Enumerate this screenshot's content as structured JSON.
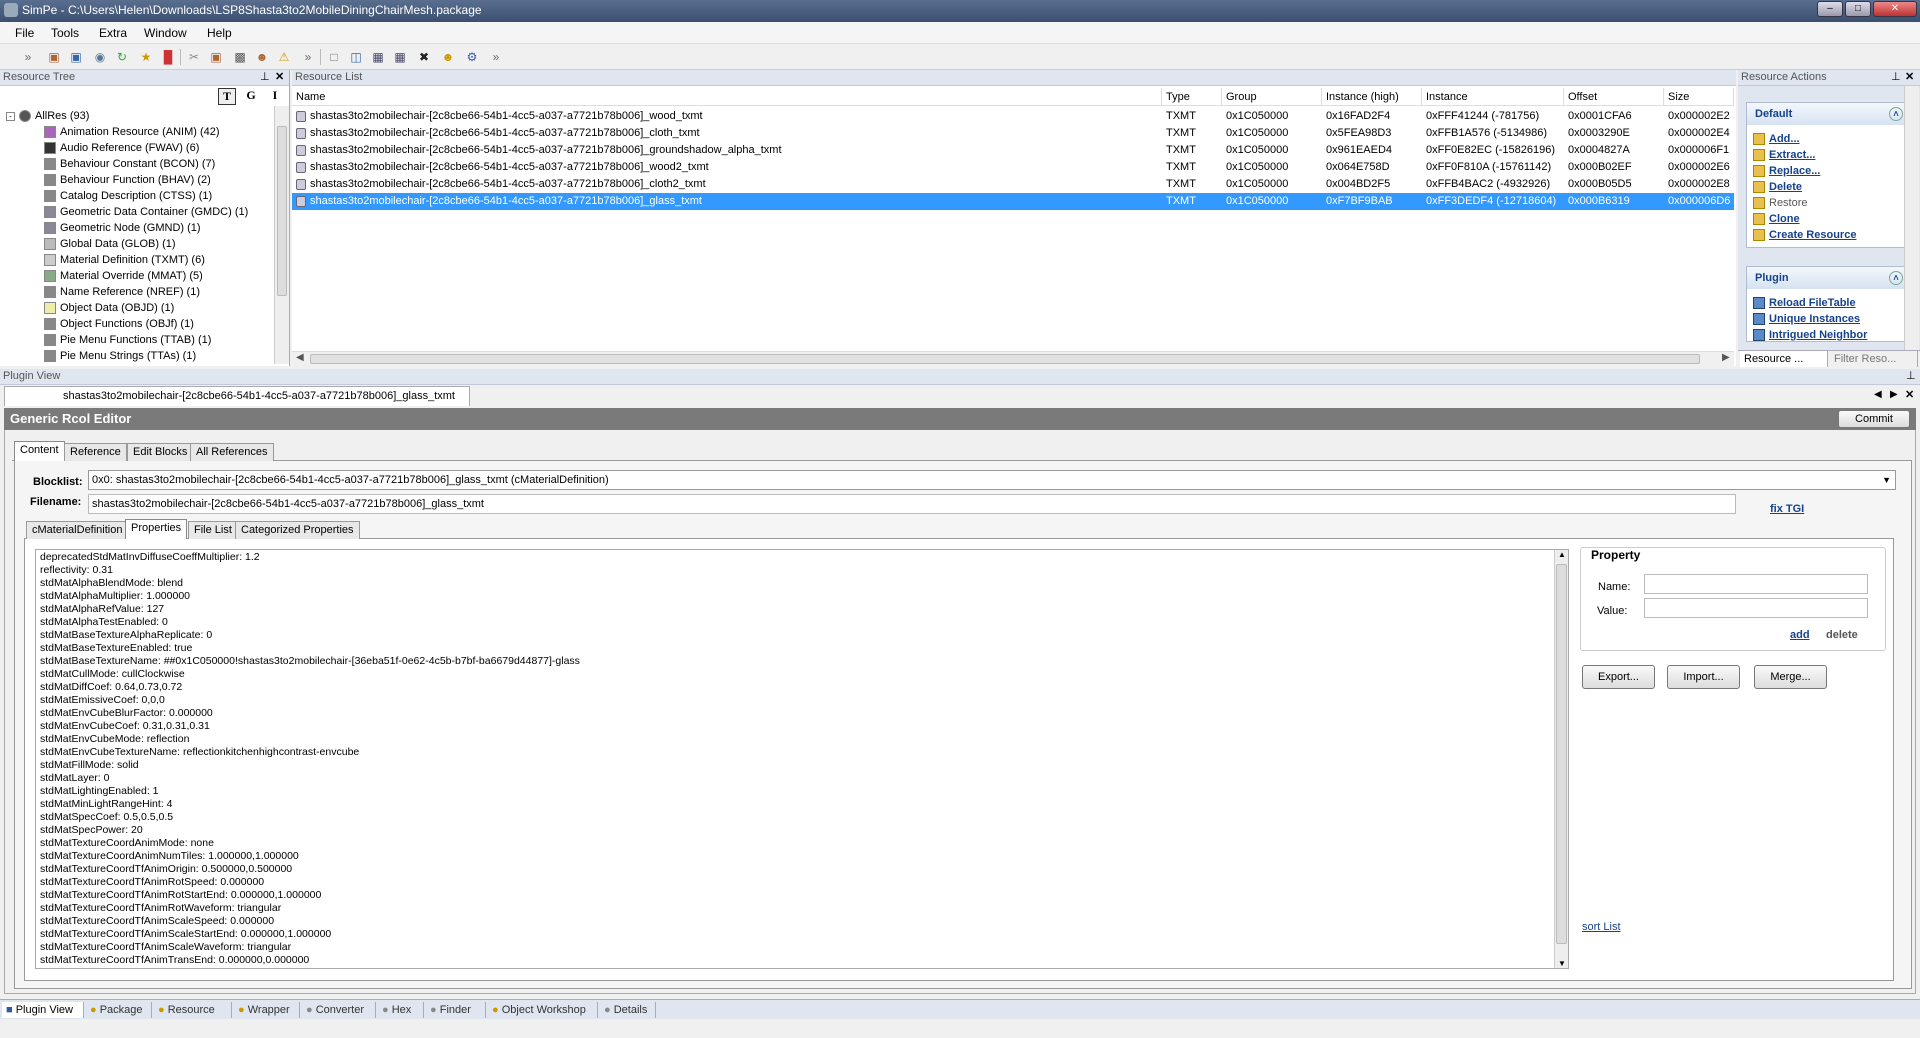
{
  "window": {
    "title": "SimPe - C:\\Users\\Helen\\Downloads\\LSP8Shasta3to2MobileDiningChairMesh.package"
  },
  "menu": [
    "File",
    "Tools",
    "Extra",
    "Window",
    "Help"
  ],
  "resource_tree": {
    "header": "Resource Tree",
    "view_buttons": [
      "T",
      "G",
      "I"
    ],
    "root": "AllRes (93)",
    "items": [
      "Animation Resource (ANIM) (42)",
      "Audio Reference (FWAV) (6)",
      "Behaviour Constant (BCON) (7)",
      "Behaviour Function (BHAV) (2)",
      "Catalog Description (CTSS) (1)",
      "Geometric Data Container (GMDC) (1)",
      "Geometric Node (GMND) (1)",
      "Global Data (GLOB) (1)",
      "Material Definition (TXMT) (6)",
      "Material Override (MMAT) (5)",
      "Name Reference (NREF) (1)",
      "Object Data (OBJD) (1)",
      "Object Functions (OBJf) (1)",
      "Pie Menu Functions (TTAB) (1)",
      "Pie Menu Strings (TTAs) (1)"
    ]
  },
  "resource_list": {
    "header": "Resource List",
    "columns": [
      "Name",
      "Type",
      "Group",
      "Instance (high)",
      "Instance",
      "Offset",
      "Size"
    ],
    "rows": [
      [
        "shastas3to2mobilechair-[2c8cbe66-54b1-4cc5-a037-a7721b78b006]_wood_txmt",
        "TXMT",
        "0x1C050000",
        "0x16FAD2F4",
        "0xFFF41244 (-781756)",
        "0x0001CFA6",
        "0x000002E2"
      ],
      [
        "shastas3to2mobilechair-[2c8cbe66-54b1-4cc5-a037-a7721b78b006]_cloth_txmt",
        "TXMT",
        "0x1C050000",
        "0x5FEA98D3",
        "0xFFB1A576 (-5134986)",
        "0x0003290E",
        "0x000002E4"
      ],
      [
        "shastas3to2mobilechair-[2c8cbe66-54b1-4cc5-a037-a7721b78b006]_groundshadow_alpha_txmt",
        "TXMT",
        "0x1C050000",
        "0x961EAED4",
        "0xFF0E82EC (-15826196)",
        "0x0004827A",
        "0x000006F1"
      ],
      [
        "shastas3to2mobilechair-[2c8cbe66-54b1-4cc5-a037-a7721b78b006]_wood2_txmt",
        "TXMT",
        "0x1C050000",
        "0x064E758D",
        "0xFF0F810A (-15761142)",
        "0x000B02EF",
        "0x000002E6"
      ],
      [
        "shastas3to2mobilechair-[2c8cbe66-54b1-4cc5-a037-a7721b78b006]_cloth2_txmt",
        "TXMT",
        "0x1C050000",
        "0x004BD2F5",
        "0xFFB4BAC2 (-4932926)",
        "0x000B05D5",
        "0x000002E8"
      ],
      [
        "shastas3to2mobilechair-[2c8cbe66-54b1-4cc5-a037-a7721b78b006]_glass_txmt",
        "TXMT",
        "0x1C050000",
        "0xF7BF9BAB",
        "0xFF3DEDF4 (-12718604)",
        "0x000B6319",
        "0x000006D6"
      ]
    ]
  },
  "resource_actions": {
    "header": "Resource Actions",
    "default_group": "Default",
    "default_actions": [
      "Add...",
      "Extract...",
      "Replace...",
      "Delete",
      "Restore",
      "Clone",
      "Create Resource"
    ],
    "plugin_group": "Plugin",
    "plugin_actions": [
      "Reload FileTable",
      "Unique Instances",
      "Intrigued Neighbor"
    ],
    "bottom_tabs": [
      "Resource ...",
      "Filter Reso..."
    ]
  },
  "plugin_view": {
    "header": "Plugin View",
    "doc_tab": "shastas3to2mobilechair-[2c8cbe66-54b1-4cc5-a037-a7721b78b006]_glass_txmt",
    "editor_title": "Generic Rcol Editor",
    "commit": "Commit",
    "tabs": [
      "Content",
      "Reference",
      "Edit Blocks",
      "All References"
    ],
    "blocklist_label": "Blocklist:",
    "blocklist_value": "0x0: shastas3to2mobilechair-[2c8cbe66-54b1-4cc5-a037-a7721b78b006]_glass_txmt (cMaterialDefinition)",
    "filename_label": "Filename:",
    "filename_value": "shastas3to2mobilechair-[2c8cbe66-54b1-4cc5-a037-a7721b78b006]_glass_txmt",
    "fix_tgi": "fix TGI",
    "subtabs": [
      "cMaterialDefinition",
      "Properties",
      "File List",
      "Categorized Properties"
    ],
    "properties": [
      "deprecatedStdMatInvDiffuseCoeffMultiplier: 1.2",
      "reflectivity: 0.31",
      "stdMatAlphaBlendMode: blend",
      "stdMatAlphaMultiplier: 1.000000",
      "stdMatAlphaRefValue: 127",
      "stdMatAlphaTestEnabled: 0",
      "stdMatBaseTextureAlphaReplicate: 0",
      "stdMatBaseTextureEnabled: true",
      "stdMatBaseTextureName: ##0x1C050000!shastas3to2mobilechair-[36eba51f-0e62-4c5b-b7bf-ba6679d44877]-glass",
      "stdMatCullMode: cullClockwise",
      "stdMatDiffCoef: 0.64,0.73,0.72",
      "stdMatEmissiveCoef: 0,0,0",
      "stdMatEnvCubeBlurFactor: 0.000000",
      "stdMatEnvCubeCoef: 0.31,0.31,0.31",
      "stdMatEnvCubeMode: reflection",
      "stdMatEnvCubeTextureName: reflectionkitchenhighcontrast-envcube",
      "stdMatFillMode: solid",
      "stdMatLayer: 0",
      "stdMatLightingEnabled: 1",
      "stdMatMinLightRangeHint: 4",
      "stdMatSpecCoef: 0.5,0.5,0.5",
      "stdMatSpecPower: 20",
      "stdMatTextureCoordAnimMode: none",
      "stdMatTextureCoordAnimNumTiles: 1.000000,1.000000",
      "stdMatTextureCoordTfAnimOrigin: 0.500000,0.500000",
      "stdMatTextureCoordTfAnimRotSpeed: 0.000000",
      "stdMatTextureCoordTfAnimRotStartEnd: 0.000000,1.000000",
      "stdMatTextureCoordTfAnimRotWaveform: triangular",
      "stdMatTextureCoordTfAnimScaleSpeed: 0.000000",
      "stdMatTextureCoordTfAnimScaleStartEnd: 0.000000,1.000000",
      "stdMatTextureCoordTfAnimScaleWaveform: triangular",
      "stdMatTextureCoordTfAnimTransEnd: 0.000000,0.000000"
    ],
    "property_group": "Property",
    "name_label": "Name:",
    "value_label": "Value:",
    "add": "add",
    "delete": "delete",
    "export": "Export...",
    "import": "Import...",
    "merge": "Merge...",
    "sort_list": "sort List"
  },
  "bottom_tabs": [
    "Plugin View",
    "Package",
    "Resource",
    "Wrapper",
    "Converter",
    "Hex",
    "Finder",
    "Object Workshop",
    "Details"
  ],
  "colors": {
    "selection": "#3399ff",
    "link": "#15428b",
    "panel_header": "#dfe6ef"
  }
}
